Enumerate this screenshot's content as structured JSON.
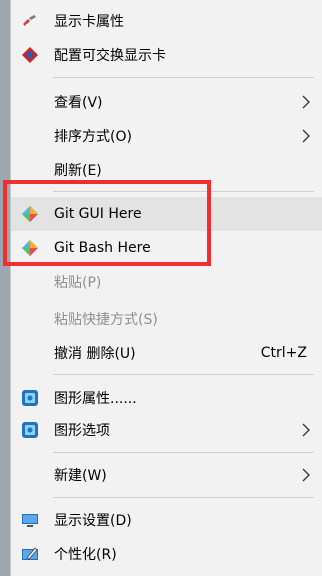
{
  "menu": {
    "items": [
      {
        "label": "显示卡属性",
        "icon": "graphics-tool-icon"
      },
      {
        "label": "配置可交换显示卡",
        "icon": "diamond-icon"
      },
      {
        "label": "查看(V)",
        "submenu": true
      },
      {
        "label": "排序方式(O)",
        "submenu": true
      },
      {
        "label": "刷新(E)"
      },
      {
        "label": "Git GUI Here",
        "icon": "git-icon"
      },
      {
        "label": "Git Bash Here",
        "icon": "git-icon"
      },
      {
        "label": "粘贴(P)",
        "disabled": true
      },
      {
        "label": "粘贴快捷方式(S)",
        "disabled": true
      },
      {
        "label": "撤消 删除(U)",
        "shortcut": "Ctrl+Z"
      },
      {
        "label": "图形属性......",
        "icon": "graphics-icon"
      },
      {
        "label": "图形选项",
        "icon": "graphics-icon",
        "submenu": true
      },
      {
        "label": "新建(W)",
        "submenu": true
      },
      {
        "label": "显示设置(D)",
        "icon": "display-icon"
      },
      {
        "label": "个性化(R)",
        "icon": "personalize-icon"
      }
    ]
  },
  "colors": {
    "highlight_border": "#ef2f2f",
    "menu_bg": "#f2f2f2",
    "disabled_text": "#8f8f8f"
  }
}
